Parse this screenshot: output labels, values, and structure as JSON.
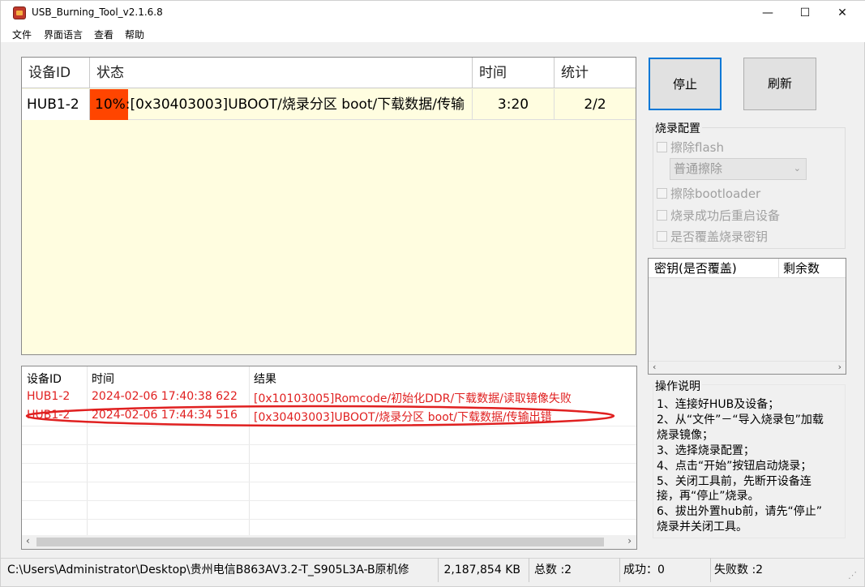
{
  "window": {
    "title": "USB_Burning_Tool_v2.1.6.8",
    "controls": {
      "min": "—",
      "max": "☐",
      "close": "✕"
    }
  },
  "menu": [
    "文件",
    "界面语言",
    "查看",
    "帮助"
  ],
  "device_table": {
    "headers": [
      "设备ID",
      "状态",
      "时间",
      "统计"
    ],
    "row": {
      "id": "HUB1-2",
      "progress_label": "10%",
      "progress_fraction": 0.1,
      "status_text": ":[0x30403003]UBOOT/烧录分区 boot/下载数据/传输",
      "time": "3:20",
      "count": "2/2"
    }
  },
  "buttons": {
    "stop": "停止",
    "refresh": "刷新"
  },
  "burn_config": {
    "title": "烧录配置",
    "erase_flash": "擦除flash",
    "erase_mode": "普通擦除",
    "erase_bootloader": "擦除bootloader",
    "reboot_after": "烧录成功后重启设备",
    "overwrite_key": "是否覆盖烧录密钥"
  },
  "key_table": {
    "headers": [
      "密钥(是否覆盖)",
      "剩余数"
    ]
  },
  "instructions": {
    "title": "操作说明",
    "lines": [
      "1、连接好HUB及设备；",
      "2、从“文件”－“导入烧录包”加载",
      "烧录镜像；",
      "3、选择烧录配置；",
      "4、点击“开始”按钮启动烧录；",
      "5、关闭工具前，先断开设备连",
      "接，再“停止”烧录。",
      "6、拔出外置hub前，请先“停止”",
      "烧录并关闭工具。"
    ]
  },
  "log_table": {
    "headers": [
      "设备ID",
      "时间",
      "结果"
    ],
    "rows": [
      {
        "id": "HUB1-2",
        "time": "2024-02-06 17:40:38 622",
        "result": "[0x10103005]Romcode/初始化DDR/下载数据/读取镜像失败"
      },
      {
        "id": "HUB1-2",
        "time": "2024-02-06 17:44:34 516",
        "result": "[0x30403003]UBOOT/烧录分区 boot/下载数据/传输出错"
      }
    ]
  },
  "statusbar": {
    "path": "C:\\Users\\Administrator\\Desktop\\贵州电信B863AV3.2-T_S905L3A-B原机修",
    "size": "2,187,854 KB",
    "total": "总数 :2",
    "success": "成功：0",
    "fail": "失败数 :2"
  },
  "colors": {
    "progress": "#ff4500",
    "error_text": "#e02020",
    "table_bg": "#fffde0",
    "annotation": "#e02020"
  }
}
